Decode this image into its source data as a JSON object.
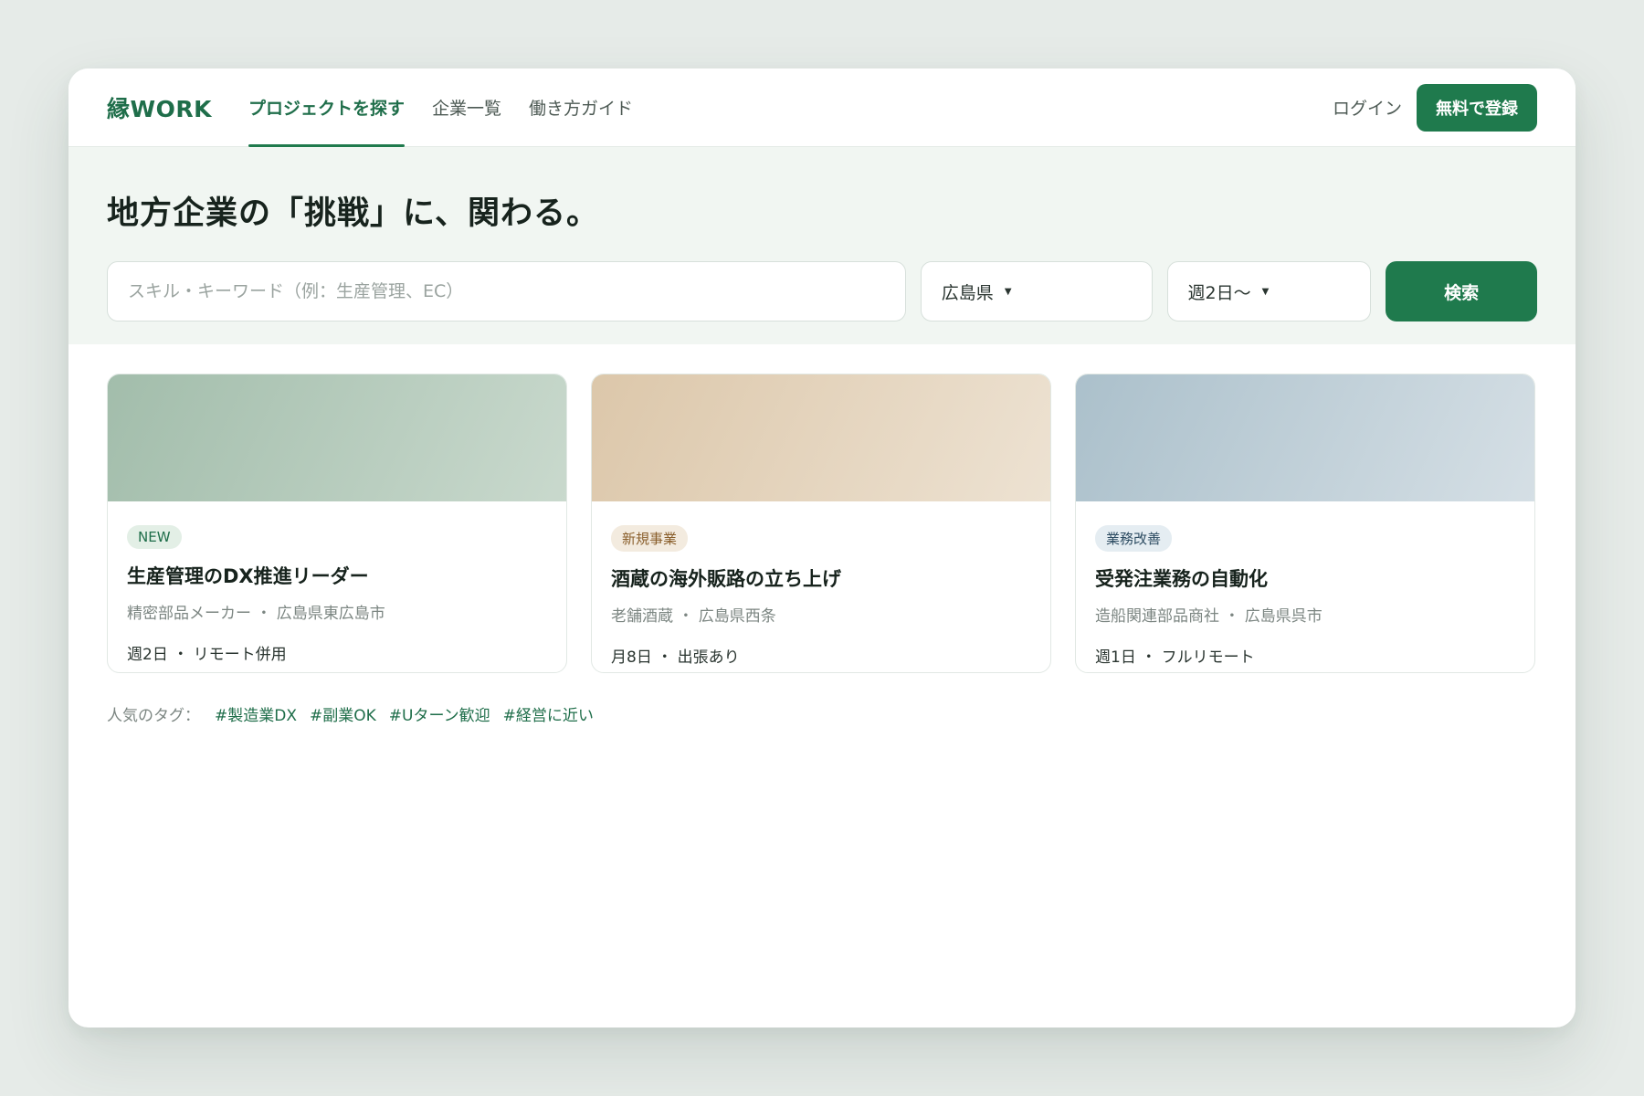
{
  "header": {
    "logo": "縁WORK",
    "nav": [
      {
        "label": "プロジェクトを探す",
        "active": true
      },
      {
        "label": "企業一覧",
        "active": false
      },
      {
        "label": "働き方ガイド",
        "active": false
      }
    ],
    "login_label": "ログイン",
    "register_label": "無料で登録"
  },
  "hero": {
    "title": "地方企業の「挑戦」に、関わる。",
    "search_placeholder": "スキル・キーワード（例：生産管理、EC）",
    "prefecture_value": "広島県",
    "days_value": "週2日〜",
    "search_button": "検索"
  },
  "cards": [
    {
      "badge": "NEW",
      "title": "生産管理のDX推進リーダー",
      "subtitle": "精密部品メーカー ・ 広島県東広島市",
      "meta": "週2日 ・ リモート併用"
    },
    {
      "badge": "新規事業",
      "title": "酒蔵の海外販路の立ち上げ",
      "subtitle": "老舗酒蔵 ・ 広島県西条",
      "meta": "月8日 ・ 出張あり"
    },
    {
      "badge": "業務改善",
      "title": "受発注業務の自動化",
      "subtitle": "造船関連部品商社 ・ 広島県呉市",
      "meta": "週1日 ・ フルリモート"
    }
  ],
  "tags": {
    "label": "人気のタグ：",
    "items": [
      "#製造業DX",
      "#副業OK",
      "#Uターン歓迎",
      "#経営に近い"
    ]
  },
  "colors": {
    "accent": "#1f7a4d",
    "hero_bg": "#f1f6f2",
    "page_bg": "#e6ebe8"
  }
}
